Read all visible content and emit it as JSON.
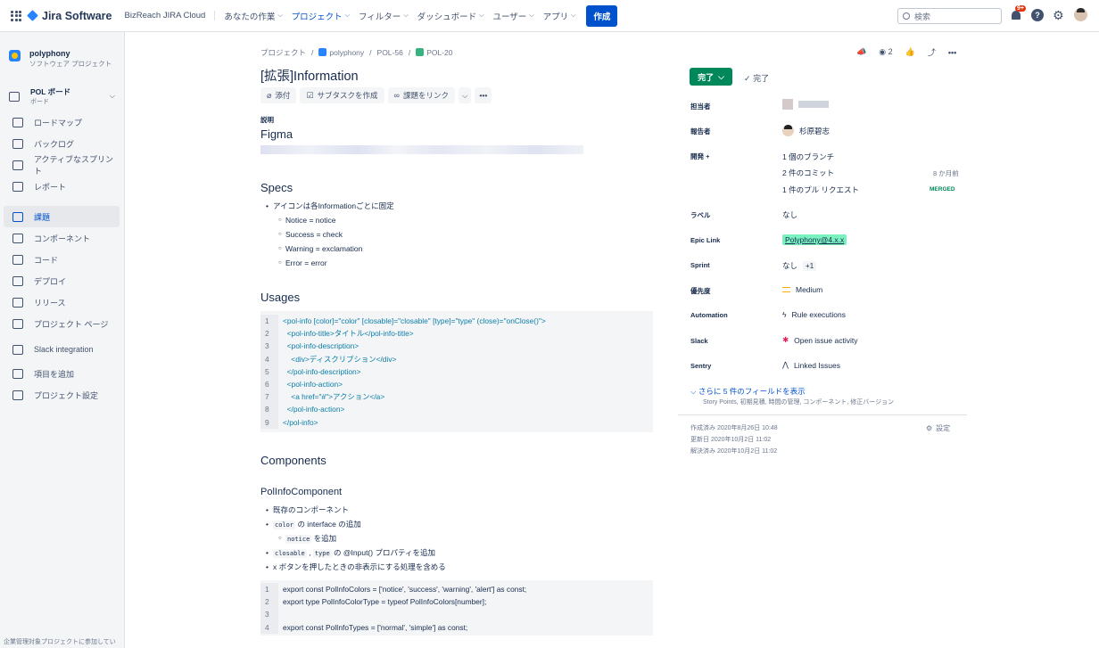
{
  "topnav": {
    "logo_text": "Jira Software",
    "site": "BizReach JIRA Cloud",
    "items": [
      {
        "label": "あなたの作業",
        "active": false
      },
      {
        "label": "プロジェクト",
        "active": true
      },
      {
        "label": "フィルター",
        "active": false
      },
      {
        "label": "ダッシュボード",
        "active": false
      },
      {
        "label": "ユーザー",
        "active": false
      },
      {
        "label": "アプリ",
        "active": false
      }
    ],
    "create_label": "作成",
    "search_placeholder": "検索",
    "notification_badge": "9+"
  },
  "sidebar": {
    "project_name": "polyphony",
    "project_type": "ソフトウェア プロジェクト",
    "board_title": "POL ボード",
    "board_sub": "ボード",
    "items": [
      {
        "label": "ロードマップ",
        "icon": "roadmap-icon"
      },
      {
        "label": "バックログ",
        "icon": "backlog-icon"
      },
      {
        "label": "アクティブなスプリント",
        "icon": "board-icon"
      },
      {
        "label": "レポート",
        "icon": "chart-icon"
      },
      {
        "label": "課題",
        "icon": "issues-icon",
        "active": true
      },
      {
        "label": "コンポーネント",
        "icon": "component-icon"
      },
      {
        "label": "コード",
        "icon": "code-icon"
      },
      {
        "label": "デプロイ",
        "icon": "cloud-icon"
      },
      {
        "label": "リリース",
        "icon": "ship-icon"
      },
      {
        "label": "プロジェクト ページ",
        "icon": "page-icon"
      },
      {
        "label": "Slack integration",
        "icon": "slack-icon"
      },
      {
        "label": "項目を追加",
        "icon": "add-item-icon"
      },
      {
        "label": "プロジェクト設定",
        "icon": "gear-icon"
      }
    ],
    "footer": "企業管理対象プロジェクトに参加してい"
  },
  "issue": {
    "breadcrumbs": [
      "プロジェクト",
      "polyphony",
      "POL-56",
      "POL-20"
    ],
    "title": "[拡張]Information",
    "actions": {
      "attach": "添付",
      "subtask": "サブタスクを作成",
      "link": "課題をリンク"
    },
    "description_label": "説明",
    "figma_heading": "Figma",
    "specs_heading": "Specs",
    "specs_items": [
      "アイコンは各Informationごとに固定",
      "Notice = notice",
      "Success = check",
      "Warning = exclamation",
      "Error = error"
    ],
    "usages_heading": "Usages",
    "usage_code": [
      "<pol-info [color]=\"color\" [closable]=\"closable\" [type]=\"type\" (close)=\"onClose()\">",
      "  <pol-info-title>タイトル</pol-info-title>",
      "  <pol-info-description>",
      "    <div>ディスクリプション</div>",
      "  </pol-info-description>",
      "  <pol-info-action>",
      "    <a href=\"#\">アクション</a>",
      "  </pol-info-action>",
      "</pol-info>"
    ],
    "components_heading": "Components",
    "component_name": "PolInfoComponent",
    "component_items": {
      "i1": "既存のコンポーネント",
      "i2_code": "color",
      "i2_text": " の interface の追加",
      "i3_code": "notice",
      "i3_text": " を追加",
      "i4_code1": "closable",
      "i4_sep": " , ",
      "i4_code2": "type",
      "i4_text": " の @Input() プロパティを追加",
      "i5": "x ボタンを押したときの非表示にする処理を含める"
    },
    "ts_code": [
      "export const PolInfoColors = ['notice', 'success', 'warning', 'alert'] as const;",
      "export type PolInfoColorType = typeof PolInfoColors[number];",
      "",
      "export const PolInfoTypes = ['normal', 'simple'] as const;"
    ]
  },
  "panel": {
    "watch_count": "2",
    "status_btn": "完了",
    "resolution": "完了",
    "fields": {
      "assignee_label": "担当者",
      "reporter_label": "報告者",
      "reporter_value": "杉原碧志",
      "dev_label": "開発",
      "branch": "1 個のブランチ",
      "commits": "2 件のコミット",
      "commits_time": "8 か月前",
      "pr": "1 件のプル リクエスト",
      "pr_status": "MERGED",
      "labels_label": "ラベル",
      "labels_value": "なし",
      "epic_label": "Epic Link",
      "epic_value": "Polyphony@4.x.x",
      "sprint_label": "Sprint",
      "sprint_value": "なし",
      "sprint_extra": "+1",
      "priority_label": "優先度",
      "priority_value": "Medium",
      "automation_label": "Automation",
      "automation_value": "Rule executions",
      "slack_label": "Slack",
      "slack_value": "Open issue activity",
      "sentry_label": "Sentry",
      "sentry_value": "Linked Issues"
    },
    "more_fields": "さらに 5 件のフィールドを表示",
    "more_fields_sub": "Story Points, 初期見積, 時間の管理, コンポーネント, 修正バージョン",
    "created": "作成済み 2020年8月26日 10:48",
    "updated": "更新日 2020年10月2日 11:02",
    "resolved": "解決済み 2020年10月2日 11:02",
    "settings": "設定"
  },
  "colors": {
    "accent": "#0052cc",
    "done": "#00875a",
    "epic": "#79f2c0"
  }
}
